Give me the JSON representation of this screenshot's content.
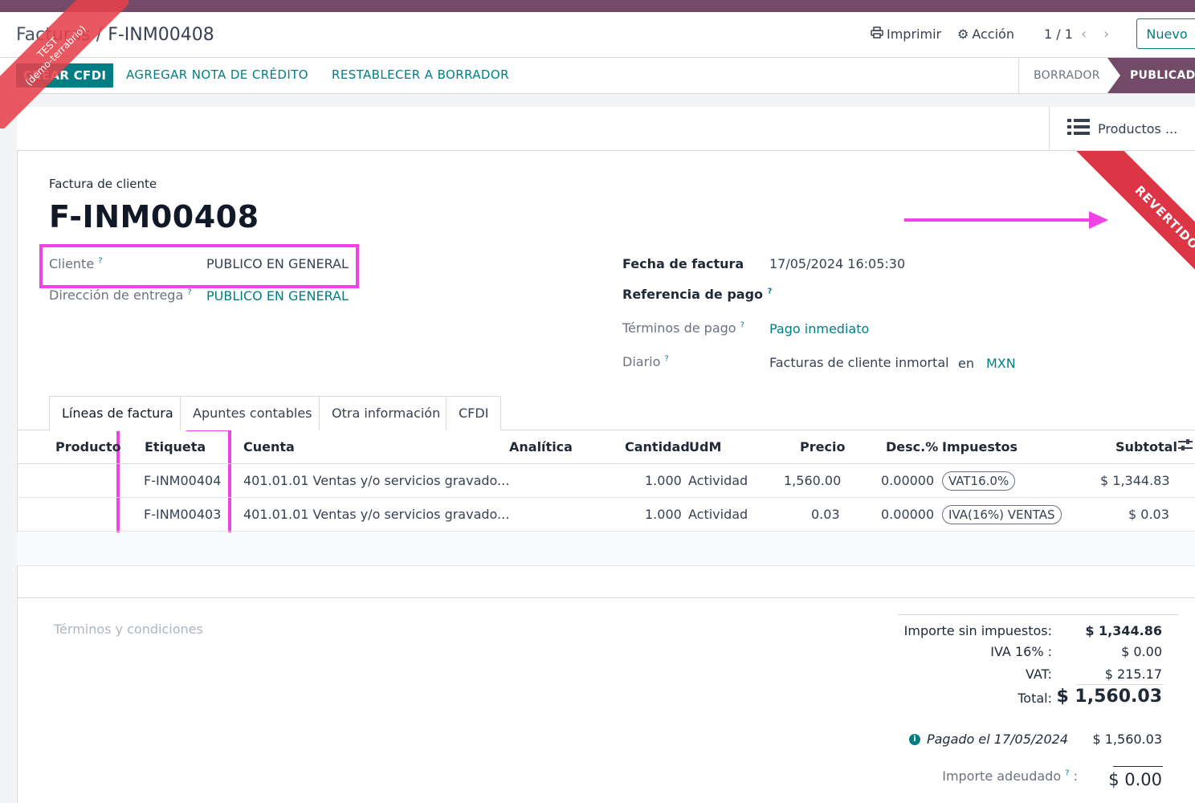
{
  "breadcrumb": {
    "parent": "Facturas",
    "separator": " / ",
    "current": "F-INM00408"
  },
  "toolbar": {
    "print_label": "Imprimir",
    "action_label": "Acción",
    "pager": "1 / 1",
    "new_label": "Nuevo"
  },
  "action_bar": {
    "create_cfdi": "CREAR CFDI",
    "credit_note": "AGREGAR NOTA DE CRÉDITO",
    "reset_draft": "RESTABLECER A BORRADOR",
    "status_draft": "BORRADOR",
    "status_posted": "PUBLICADO"
  },
  "smart_button": {
    "label": "Productos ...",
    "icon": "list-icon"
  },
  "ribbon": "REVERTIDO",
  "test_banner": {
    "line1": "TEST",
    "line2": "(demo-terrabrio)"
  },
  "header": {
    "kind": "Factura de cliente",
    "name": "F-INM00408"
  },
  "fields_left": {
    "customer_label": "Cliente",
    "customer_value": "PUBLICO EN GENERAL",
    "delivery_label": "Dirección de entrega",
    "delivery_value": "PUBLICO EN GENERAL"
  },
  "fields_right": {
    "date_label": "Fecha de factura",
    "date_value": "17/05/2024 16:05:30",
    "payref_label": "Referencia de pago",
    "terms_label": "Términos de pago",
    "terms_value": "Pago inmediato",
    "journal_label": "Diario",
    "journal_value": "Facturas de cliente inmortal",
    "journal_in": "en",
    "currency": "MXN"
  },
  "tooltip_mark": "?",
  "tabs": [
    "Líneas de factura",
    "Apuntes contables",
    "Otra información",
    "CFDI"
  ],
  "table": {
    "headers": [
      "Producto",
      "Etiqueta",
      "Cuenta",
      "Analítica",
      "Cantidad",
      "UdM",
      "Precio",
      "Desc.%",
      "Impuestos",
      "Subtotal"
    ],
    "rows": [
      {
        "label": "F-INM00404",
        "account": "401.01.01 Ventas y/o servicios gravado...",
        "qty": "1.000",
        "uom": "Actividad",
        "price": "1,560.00",
        "disc": "0.00000",
        "tax": "VAT16.0%",
        "subtotal": "$ 1,344.83"
      },
      {
        "label": "F-INM00403",
        "account": "401.01.01 Ventas y/o servicios gravado...",
        "qty": "1.000",
        "uom": "Actividad",
        "price": "0.03",
        "disc": "0.00000",
        "tax": "IVA(16%) VENTAS",
        "subtotal": "$ 0.03"
      }
    ]
  },
  "terms_placeholder": "Términos y condiciones",
  "totals": {
    "untaxed_label": "Importe sin impuestos:",
    "untaxed_value": "$ 1,344.86",
    "iva_label": "IVA 16% :",
    "iva_value": "$ 0.00",
    "vat_label": "VAT:",
    "vat_value": "$ 215.17",
    "total_label": "Total:",
    "total_value": "$ 1,560.03",
    "paid_label": "Pagado el 17/05/2024",
    "paid_value": "$ 1,560.03",
    "due_label": "Importe adeudado",
    "due_colon": ":",
    "due_value": "$ 0.00"
  },
  "colors": {
    "brand": "#714b67",
    "accent": "#017e84",
    "highlight": "#ee44e6",
    "ribbon": "#dc3545"
  }
}
